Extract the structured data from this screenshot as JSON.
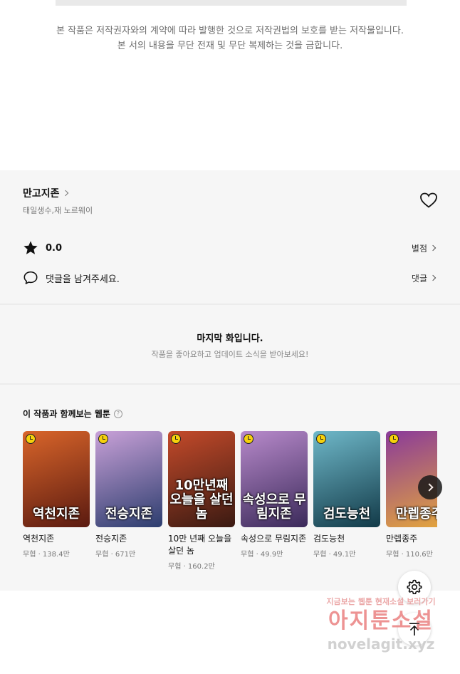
{
  "copyright": {
    "line1": "본 작품은 저작권자와의 계약에 따라 발행한 것으로 저작권법의 보호를 받는 저작물입니다.",
    "line2": "본 서의 내용을 무단 전재 및 무단 복제하는 것을 금합니다."
  },
  "work": {
    "title": "만고지존",
    "authors": "태일생수,재 노르웨이",
    "rating": "0.0",
    "rating_link": "별점",
    "comment_prompt": "댓글을 남겨주세요.",
    "comment_link": "댓글"
  },
  "last_episode": {
    "title": "마지막 화입니다.",
    "subtitle": "작품을 좋아요하고 업데이트 소식을 받아보세요!"
  },
  "recommendations": {
    "header": "이 작품과 함께보는 웹툰",
    "help_icon": "?",
    "items": [
      {
        "title": "역천지존",
        "meta": "무협 · 138.4만",
        "cover_text": "역천지존",
        "colors": [
          "#5a1a10",
          "#d9652a"
        ]
      },
      {
        "title": "전승지존",
        "meta": "무협 · 671만",
        "cover_text": "전승지존",
        "colors": [
          "#2c3d6e",
          "#c9a1d8"
        ]
      },
      {
        "title": "10만 년째 오늘을 살던 놈",
        "meta": "무협 · 160.2만",
        "cover_text": "10만년째 오늘을 살던 놈",
        "colors": [
          "#3a1a12",
          "#c44a2a"
        ]
      },
      {
        "title": "속성으로 무림지존",
        "meta": "무협 · 49.9만",
        "cover_text": "속성으로 무림지존",
        "colors": [
          "#3b2a5a",
          "#b88acb"
        ]
      },
      {
        "title": "검도능천",
        "meta": "무협 · 49.1만",
        "cover_text": "검도능천",
        "colors": [
          "#123a48",
          "#6fb8c9"
        ]
      },
      {
        "title": "만렙종주",
        "meta": "무협 · 110.6만",
        "cover_text": "만렙종주",
        "colors": [
          "#e6a83a",
          "#8a3a9a"
        ]
      }
    ]
  },
  "watermark": {
    "top": "지금보는 웹툰 현재소설 보러가기",
    "big": "아지툰소설",
    "url": "novelagit.xyz"
  }
}
